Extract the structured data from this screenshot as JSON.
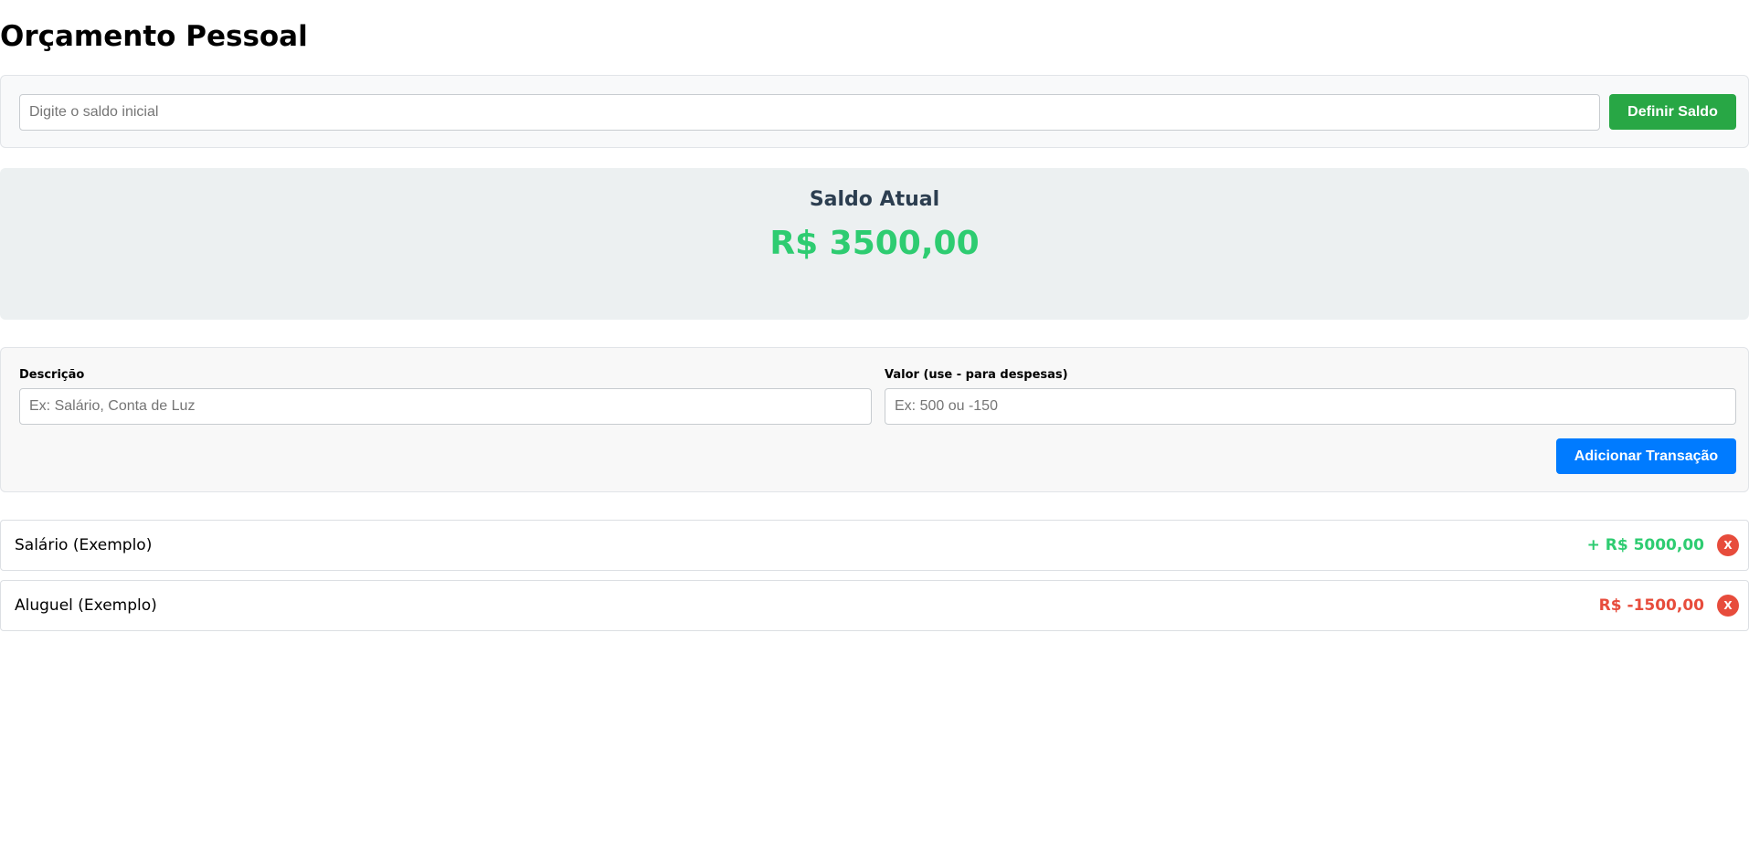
{
  "page": {
    "title": "Orçamento Pessoal"
  },
  "initial_balance": {
    "placeholder": "Digite o saldo inicial",
    "value": "",
    "button_label": "Definir Saldo"
  },
  "balance": {
    "title": "Saldo Atual",
    "value": "R$ 3500,00",
    "color": "#2ecc71"
  },
  "transaction_form": {
    "description_label": "Descrição",
    "description_placeholder": "Ex: Salário, Conta de Luz",
    "amount_label": "Valor (use - para despesas)",
    "amount_placeholder": "Ex: 500 ou -150",
    "submit_label": "Adicionar Transação"
  },
  "transactions": [
    {
      "description": "Salário (Exemplo)",
      "amount": "+ R$ 5000,00",
      "type": "income",
      "color": "#2ecc71",
      "delete_label": "X"
    },
    {
      "description": "Aluguel (Exemplo)",
      "amount": "R$ -1500,00",
      "type": "expense",
      "color": "#e74c3c",
      "delete_label": "X"
    }
  ],
  "colors": {
    "primary_button": "#007bff",
    "success_button": "#28a745",
    "delete_button": "#e74c3c",
    "income": "#2ecc71",
    "expense": "#e74c3c",
    "balance_title": "#2c3e50"
  }
}
